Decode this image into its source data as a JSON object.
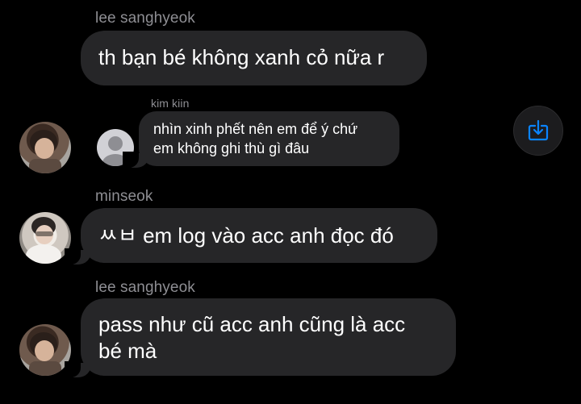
{
  "messages": [
    {
      "sender": "lee sanghyeok",
      "text": "th bạn bé không xanh cỏ nữa r"
    },
    {
      "sender": "kim kiin",
      "line1": "nhìn xinh phết nên em để ý chứ",
      "line2": "em không ghi thù gì đâu"
    },
    {
      "sender": "minseok",
      "text": "ㅆㅂ em log vào acc anh đọc đó"
    },
    {
      "sender": "lee sanghyeok",
      "line1": "pass như cũ acc anh cũng là acc",
      "line2": "bé mà"
    }
  ],
  "icons": {
    "share": "share-icon",
    "placeholder_avatar": "person-icon"
  },
  "colors": {
    "background": "#000000",
    "bubble": "#262628",
    "accent": "#0a84ff",
    "name": "#8e8e93"
  }
}
